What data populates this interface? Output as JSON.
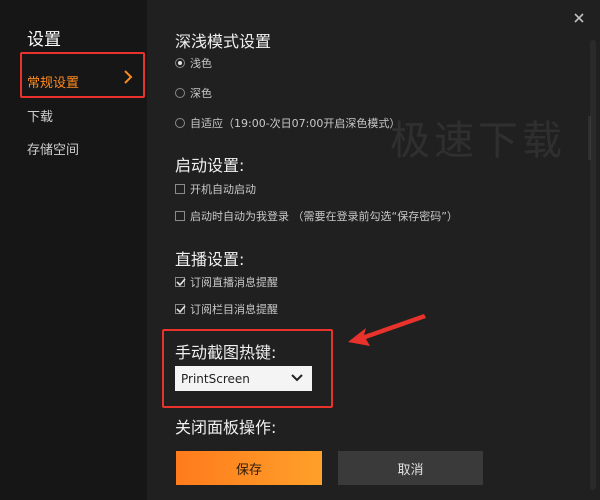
{
  "sidebar": {
    "title": "设置",
    "items": [
      {
        "label": "常规设置",
        "active": true
      },
      {
        "label": "下载"
      },
      {
        "label": "存储空间"
      }
    ]
  },
  "theme": {
    "title": "深浅模式设置",
    "options": [
      "浅色",
      "深色",
      "自适应（19:00-次日07:00开启深色模式）"
    ],
    "selected": "浅色"
  },
  "startup": {
    "title": "启动设置:",
    "options": [
      {
        "label": "开机自动启动",
        "checked": false
      },
      {
        "label": "启动时自动为我登录 （需要在登录前勾选“保存密码”）",
        "checked": false
      }
    ]
  },
  "live": {
    "title": "直播设置:",
    "options": [
      {
        "label": "订阅直播消息提醒",
        "checked": true
      },
      {
        "label": "订阅栏目消息提醒",
        "checked": true
      }
    ]
  },
  "screenshot": {
    "title": "手动截图热键:",
    "value": "PrintScreen"
  },
  "close_panel": {
    "title": "关闭面板操作:"
  },
  "buttons": {
    "save": "保存",
    "cancel": "取消"
  },
  "watermark": "极速下载",
  "colors": {
    "accent": "#ff8a1e",
    "highlight": "#e8322b"
  },
  "icons": [
    "chevron-right-icon",
    "close-icon",
    "chevron-down-icon",
    "check-icon",
    "arrow-annotation-icon"
  ]
}
